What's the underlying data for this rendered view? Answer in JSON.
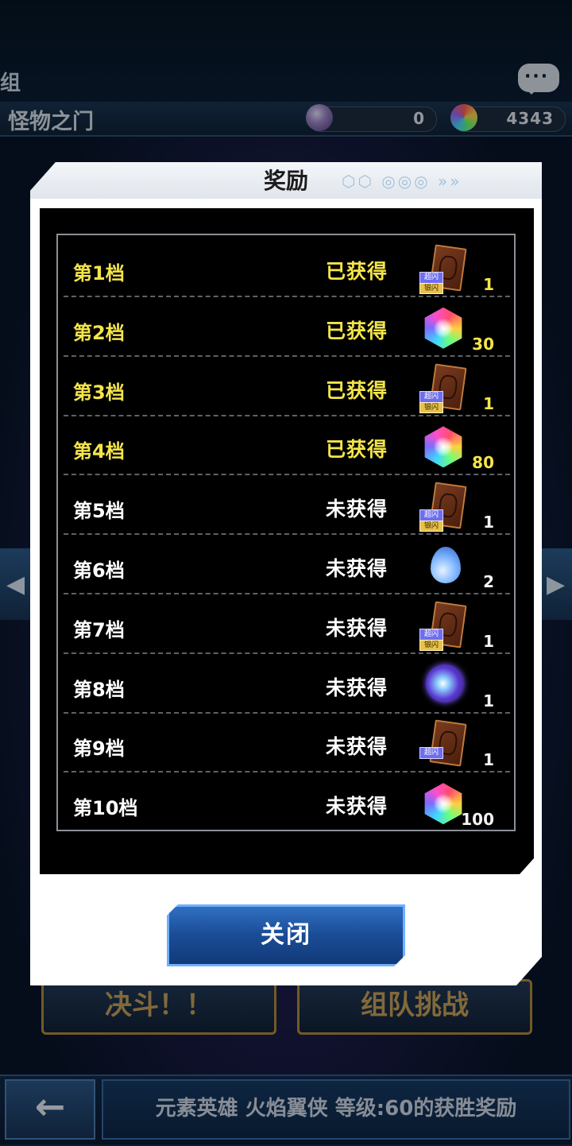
{
  "background": {
    "top_label": "组",
    "header_title": "怪物之门",
    "currencies": [
      {
        "icon": "orb-currency-icon",
        "value": "0"
      },
      {
        "icon": "rainbow-gem-icon",
        "value": "4343"
      }
    ],
    "bottom_buttons": [
      {
        "label": "决斗！！"
      },
      {
        "label": "组队挑战"
      }
    ],
    "footer_text": "元素英雄 火焰翼侠 等级:60的获胜奖励",
    "back_label": "←"
  },
  "dialog": {
    "title": "奖励",
    "close_label": "关闭",
    "rows": [
      {
        "tier": "第1档",
        "status": "已获得",
        "item": "card-pack",
        "badges": [
          "超闪",
          "银闪"
        ],
        "qty": "1",
        "obtained": true
      },
      {
        "tier": "第2档",
        "status": "已获得",
        "item": "rainbow-gem",
        "qty": "30",
        "obtained": true
      },
      {
        "tier": "第3档",
        "status": "已获得",
        "item": "card-pack",
        "badges": [
          "超闪",
          "银闪"
        ],
        "qty": "1",
        "obtained": true
      },
      {
        "tier": "第4档",
        "status": "已获得",
        "item": "rainbow-gem",
        "qty": "80",
        "obtained": true
      },
      {
        "tier": "第5档",
        "status": "未获得",
        "item": "card-pack",
        "badges": [
          "超闪",
          "银闪"
        ],
        "qty": "1",
        "obtained": false
      },
      {
        "tier": "第6档",
        "status": "未获得",
        "item": "blue-drop",
        "qty": "2",
        "obtained": false
      },
      {
        "tier": "第7档",
        "status": "未获得",
        "item": "card-pack",
        "badges": [
          "超闪",
          "银闪"
        ],
        "qty": "1",
        "obtained": false
      },
      {
        "tier": "第8档",
        "status": "未获得",
        "item": "purple-orb",
        "qty": "1",
        "obtained": false
      },
      {
        "tier": "第9档",
        "status": "未获得",
        "item": "card-pack",
        "badges": [
          "超闪"
        ],
        "qty": "1",
        "obtained": false
      },
      {
        "tier": "第10档",
        "status": "未获得",
        "item": "rainbow-gem",
        "qty": "100",
        "obtained": false
      }
    ]
  },
  "colors": {
    "obtained_text": "#f4e54a",
    "unobtained_text": "#ffffff",
    "close_button": "#1a4c96"
  }
}
